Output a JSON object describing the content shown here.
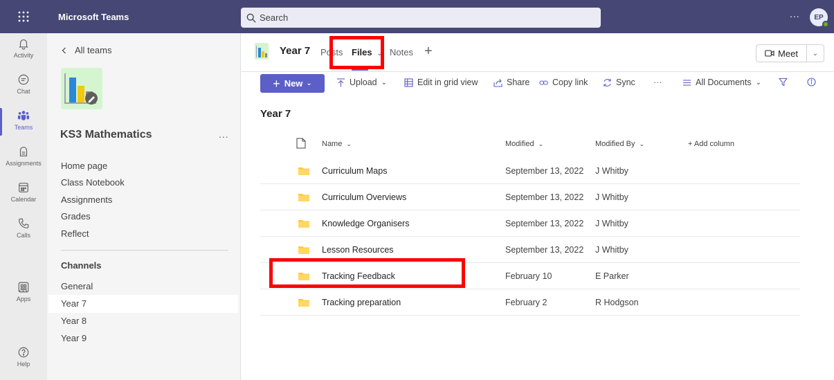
{
  "topbar": {
    "app_name": "Microsoft Teams",
    "search_placeholder": "Search",
    "more": "...",
    "avatar_initials": "EP"
  },
  "rail": {
    "items": [
      {
        "label": "Activity",
        "icon": "bell-icon"
      },
      {
        "label": "Chat",
        "icon": "chat-icon"
      },
      {
        "label": "Teams",
        "icon": "teams-icon",
        "active": true
      },
      {
        "label": "Assignments",
        "icon": "assignments-icon"
      },
      {
        "label": "Calendar",
        "icon": "calendar-icon"
      },
      {
        "label": "Calls",
        "icon": "phone-icon"
      },
      {
        "label": "Apps",
        "icon": "apps-icon"
      },
      {
        "label": "Help",
        "icon": "help-icon"
      }
    ],
    "more": "..."
  },
  "team": {
    "back_label": "All teams",
    "name": "KS3 Mathematics",
    "more": "...",
    "links": [
      "Home page",
      "Class Notebook",
      "Assignments",
      "Grades",
      "Reflect"
    ],
    "channels_heading": "Channels",
    "channels": [
      "General",
      "Year 7",
      "Year 8",
      "Year 9"
    ],
    "selected_channel": "Year 7"
  },
  "channel_header": {
    "title": "Year 7",
    "tabs": [
      "Posts",
      "Files",
      "Notes"
    ],
    "active_tab": "Files",
    "meet_label": "Meet"
  },
  "toolbar": {
    "new_label": "New",
    "upload_label": "Upload",
    "grid_label": "Edit in grid view",
    "share_label": "Share",
    "copy_link_label": "Copy link",
    "sync_label": "Sync",
    "more": "···",
    "view_label": "All Documents"
  },
  "library": {
    "title": "Year 7",
    "columns": {
      "name": "Name",
      "modified": "Modified",
      "modified_by": "Modified By",
      "add_column": "+ Add column"
    },
    "rows": [
      {
        "name": "Curriculum Maps",
        "modified": "September 13, 2022",
        "modified_by": "J Whitby"
      },
      {
        "name": "Curriculum Overviews",
        "modified": "September 13, 2022",
        "modified_by": "J Whitby"
      },
      {
        "name": "Knowledge Organisers",
        "modified": "September 13, 2022",
        "modified_by": "J Whitby"
      },
      {
        "name": "Lesson Resources",
        "modified": "September 13, 2022",
        "modified_by": "J Whitby"
      },
      {
        "name": "Tracking Feedback",
        "modified": "February 10",
        "modified_by": "E Parker"
      },
      {
        "name": "Tracking preparation",
        "modified": "February 2",
        "modified_by": "R Hodgson"
      }
    ]
  },
  "colors": {
    "brand": "#464775",
    "accent": "#5b5fc7",
    "highlight": "#ff0000",
    "folder": "#ffc83d"
  }
}
